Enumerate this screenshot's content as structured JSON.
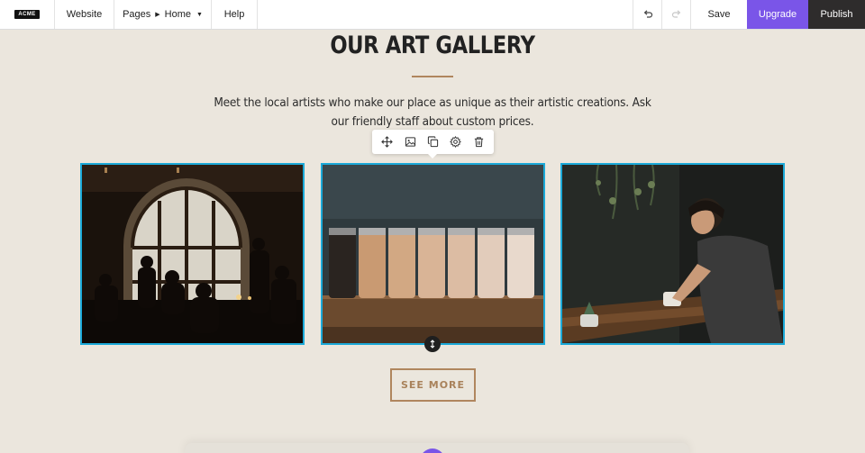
{
  "toolbar": {
    "logo": "ACME",
    "website": "Website",
    "pages": "Pages",
    "current_page": "Home",
    "help": "Help",
    "save": "Save",
    "upgrade": "Upgrade",
    "publish": "Publish"
  },
  "gallery": {
    "title": "OUR ART GALLERY",
    "description": "Meet the local artists who make our place as unique as their artistic creations. Ask our friendly staff about custom prices.",
    "see_more": "SEE MORE"
  },
  "edit_toolbar": {
    "icons": [
      "move-icon",
      "image-icon",
      "duplicate-icon",
      "settings-icon",
      "trash-icon"
    ]
  },
  "colors": {
    "accent": "#7a55e8",
    "brand_brown": "#b0865e",
    "selection": "#1ba9d8",
    "background": "#ebe6dd"
  }
}
